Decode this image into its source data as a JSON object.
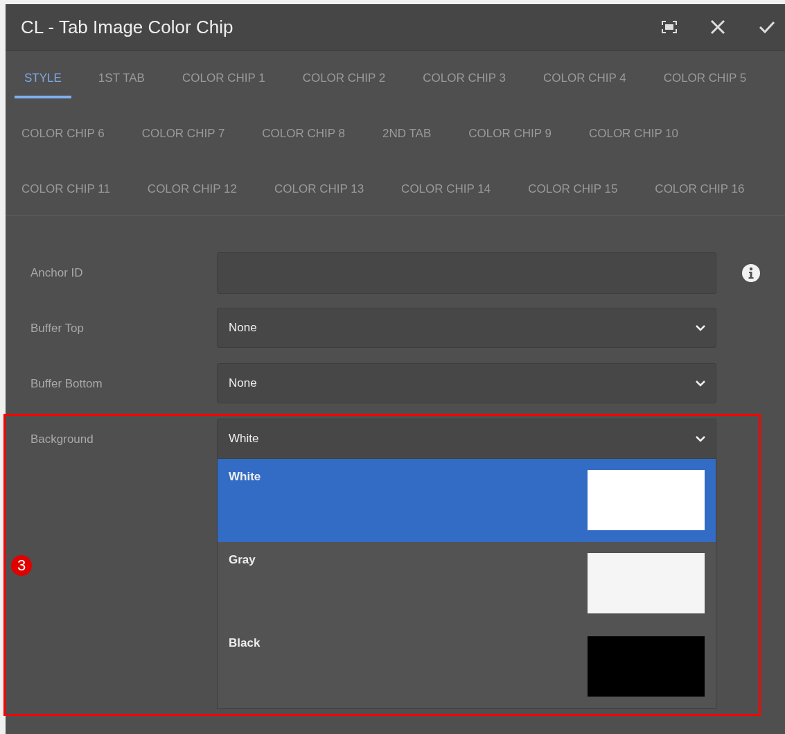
{
  "dialog": {
    "title": "CL - Tab Image Color Chip"
  },
  "tabs": [
    {
      "label": "STYLE",
      "selected": true
    },
    {
      "label": "1ST TAB",
      "selected": false
    },
    {
      "label": "COLOR CHIP 1",
      "selected": false
    },
    {
      "label": "COLOR CHIP 2",
      "selected": false
    },
    {
      "label": "COLOR CHIP 3",
      "selected": false
    },
    {
      "label": "COLOR CHIP 4",
      "selected": false
    },
    {
      "label": "COLOR CHIP 5",
      "selected": false
    },
    {
      "label": "COLOR CHIP 6",
      "selected": false
    },
    {
      "label": "COLOR CHIP 7",
      "selected": false
    },
    {
      "label": "COLOR CHIP 8",
      "selected": false
    },
    {
      "label": "2ND TAB",
      "selected": false
    },
    {
      "label": "COLOR CHIP 9",
      "selected": false
    },
    {
      "label": "COLOR CHIP 10",
      "selected": false
    },
    {
      "label": "COLOR CHIP 11",
      "selected": false
    },
    {
      "label": "COLOR CHIP 12",
      "selected": false
    },
    {
      "label": "COLOR CHIP 13",
      "selected": false
    },
    {
      "label": "COLOR CHIP 14",
      "selected": false
    },
    {
      "label": "COLOR CHIP 15",
      "selected": false
    },
    {
      "label": "COLOR CHIP 16",
      "selected": false
    }
  ],
  "fields": [
    {
      "kind": "text",
      "label": "Anchor ID",
      "info": true
    },
    {
      "kind": "select",
      "label": "Buffer Top",
      "value": "None",
      "expanded": false
    },
    {
      "kind": "select",
      "label": "Buffer Bottom",
      "value": "None",
      "expanded": false
    },
    {
      "kind": "select",
      "label": "Background",
      "value": "White",
      "expanded": true,
      "highlighted": true,
      "options": [
        {
          "label": "White",
          "selected": true,
          "color": "#ffffff"
        },
        {
          "label": "Gray",
          "selected": false,
          "color": "#f5f5f5"
        },
        {
          "label": "Black",
          "selected": false,
          "color": "#000000"
        }
      ]
    }
  ],
  "annotation": {
    "number": "3"
  }
}
